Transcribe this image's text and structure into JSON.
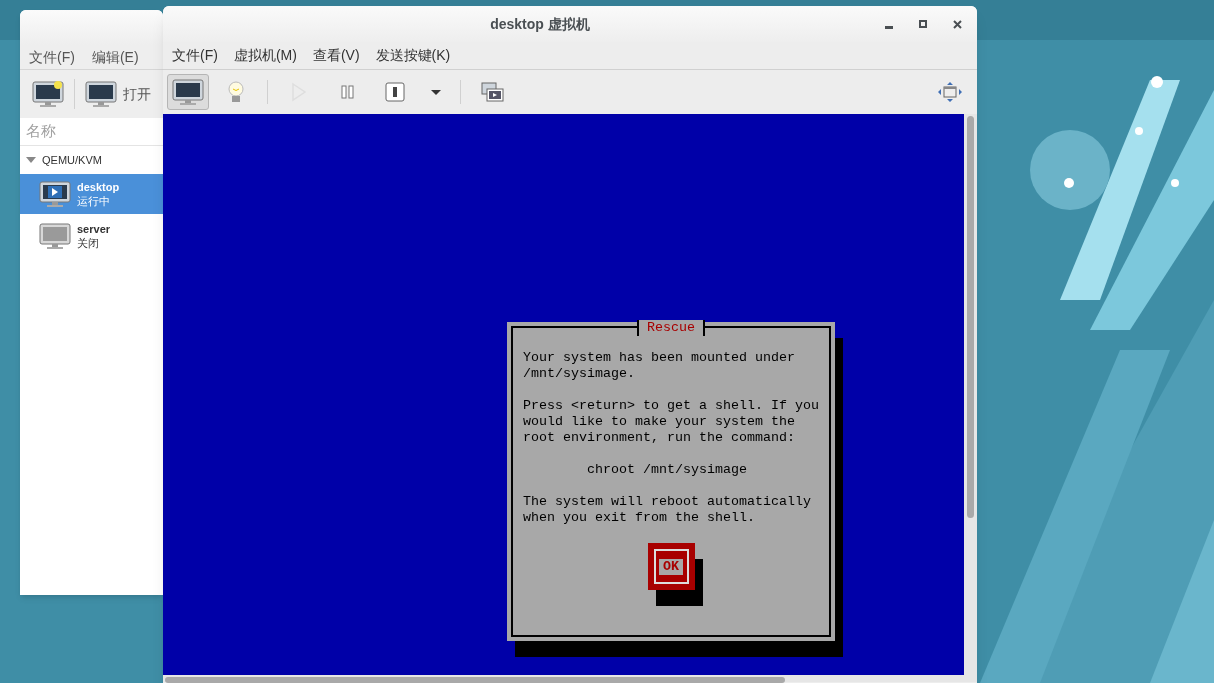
{
  "manager_window": {
    "menu": [
      "文件(F)",
      "编辑(E)"
    ],
    "toolbar": [
      {
        "kind": "new"
      },
      {
        "kind": "open",
        "label": "打开"
      }
    ],
    "column_header": "名称",
    "tree": {
      "label": "QEMU/KVM",
      "expanded": true,
      "children": [
        {
          "name": "desktop",
          "status": "运行中",
          "running": true,
          "selected": true
        },
        {
          "name": "server",
          "status": "关闭",
          "running": false,
          "selected": false
        }
      ]
    }
  },
  "vm_window": {
    "title": "desktop 虚拟机",
    "menu": [
      "文件(F)",
      "虚拟机(M)",
      "查看(V)",
      "发送按键(K)"
    ],
    "toolbar_groups": [
      [
        {
          "kind": "console",
          "selected": true,
          "disabled": false
        },
        {
          "kind": "details",
          "selected": false,
          "disabled": false
        }
      ],
      [
        {
          "kind": "run",
          "selected": false,
          "disabled": true
        },
        {
          "kind": "pause",
          "selected": false,
          "disabled": false
        },
        {
          "kind": "shutdown",
          "selected": false,
          "disabled": false
        },
        {
          "kind": "menu",
          "selected": false,
          "disabled": false
        }
      ],
      [
        {
          "kind": "screenshot",
          "selected": false,
          "disabled": false
        }
      ]
    ],
    "console": {
      "dialog": {
        "title": "Rescue",
        "paragraphs": [
          {
            "kind": "text",
            "lines": [
              "Your system has been mounted under",
              "/mnt/sysimage."
            ]
          },
          {
            "kind": "text",
            "lines": [
              "Press <return> to get a shell. If you",
              "would like to make your system the",
              "root environment, run the command:"
            ]
          },
          {
            "kind": "command",
            "lines": [
              "chroot /mnt/sysimage"
            ]
          },
          {
            "kind": "text",
            "lines": [
              "The system will reboot automatically",
              "when you exit from the shell."
            ]
          }
        ],
        "button": {
          "label": "OK",
          "focused": true
        }
      }
    }
  }
}
